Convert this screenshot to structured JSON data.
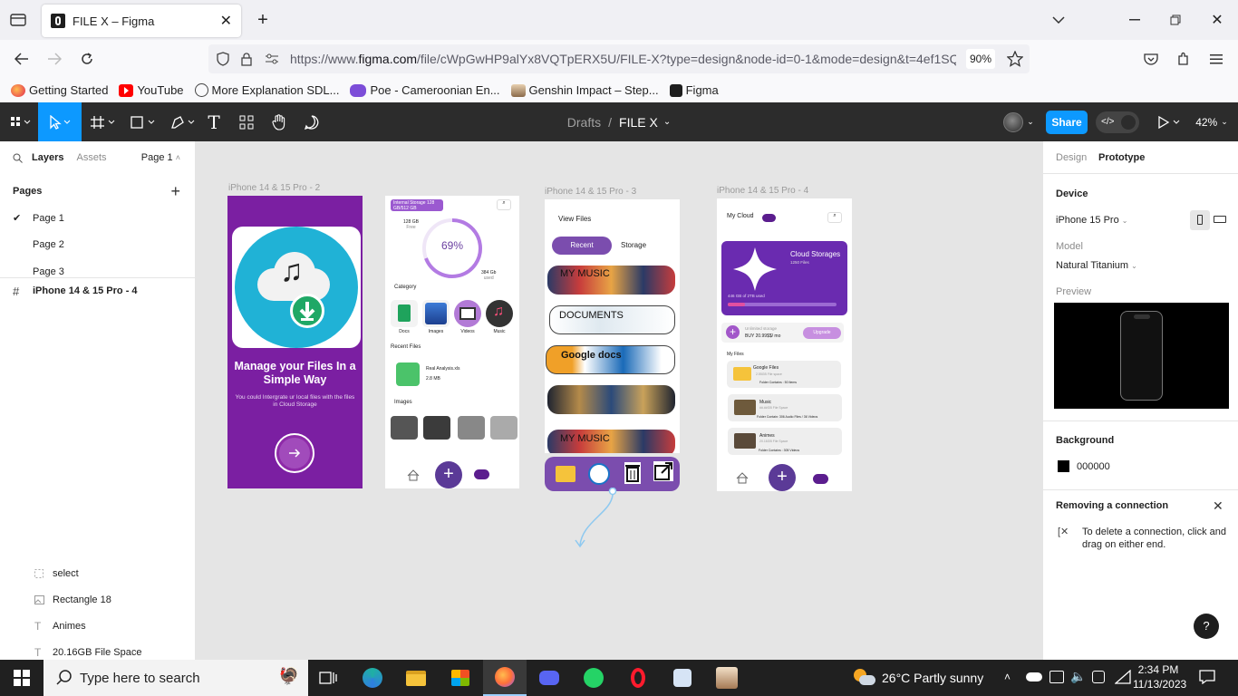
{
  "browser": {
    "tab_title": "FILE X – Figma",
    "url_prefix": "https://www.",
    "url_domain": "figma.com",
    "url_rest": "/file/cWpGwHP9alYx8VQTpERX5U/FILE-X?type=design&node-id=0-1&mode=design&t=4ef1SQ",
    "zoom": "90%",
    "bookmarks": [
      "Getting Started",
      "YouTube",
      "More Explanation SDL...",
      "Poe - Cameroonian En...",
      "Genshin Impact – Step...",
      "Figma"
    ]
  },
  "toolbar": {
    "breadcrumb_drafts": "Drafts",
    "breadcrumb_sep": "/",
    "file_name": "FILE X",
    "share_label": "Share",
    "zoom": "42%"
  },
  "left_panel": {
    "tabs": [
      "Layers",
      "Assets"
    ],
    "page_selector": "Page 1",
    "pages_title": "Pages",
    "pages": [
      "Page 1",
      "Page 2",
      "Page 3"
    ],
    "selected_frame": "iPhone 14 & 15 Pro - 4",
    "layers": [
      "select",
      "Rectangle 18",
      "Animes",
      "20.16GB File Space"
    ]
  },
  "canvas": {
    "frame_labels": [
      "iPhone 14 & 15 Pro - 2",
      "iPhone 14 & 15 Pro - 3",
      "iPhone 14 & 15 Pro - 4"
    ],
    "f1": {
      "title": "Manage your Files In a Simple Way",
      "subtitle": "You could Intergrate ur  local files with the files in Cloud Storage"
    },
    "f2": {
      "storage_badge": "Internal Storage 128 GB/512 GB",
      "total": "128 GB",
      "total_sub": "Free",
      "percent": "69%",
      "used": "384 Gb",
      "used_sub": "used",
      "category": "Category",
      "cats": [
        "Docs",
        "Images",
        "Videos",
        "Music"
      ],
      "recent": "Recent Files",
      "recent_file": "Real Analysis.xls",
      "recent_size": "2.8 MB",
      "images": "Images"
    },
    "f3": {
      "view_files": "View Files",
      "tab_recent": "Recent",
      "tab_storage": "Storage",
      "cards": [
        "MY MUSIC",
        "DOCUMENTS",
        "Google docs",
        "",
        "MY MUSIC"
      ]
    },
    "f4": {
      "title": "My Cloud",
      "cloud_storages": "Cloud Storages",
      "cloud_files": "1250 Files",
      "usage_text": "446 GB of 2TB used",
      "unlimited": "Unlimited storage",
      "buy": "BUY 20.99$$/ mo",
      "upgrade": "Upgrade",
      "my_files": "My Files",
      "folders": [
        {
          "name": "Google Files",
          "size": "2.55GB File space",
          "meta": "Folder Contains : 50 Items"
        },
        {
          "name": "Music",
          "size": "##.##GB File Space",
          "meta": "Folder Contain: 306 Audio Files / 36 Videos"
        },
        {
          "name": "Animes",
          "size": "20.16GB File Space",
          "meta": "Folder Contains : 305 Videos"
        }
      ]
    }
  },
  "right_panel": {
    "tabs": [
      "Design",
      "Prototype"
    ],
    "device_title": "Device",
    "device": "iPhone 15 Pro",
    "model_label": "Model",
    "model": "Natural Titanium",
    "preview_label": "Preview",
    "background_title": "Background",
    "background_hex": "000000",
    "note_title": "Removing a connection",
    "note_text": "To delete a connection, click and drag on either end.",
    "help": "?"
  },
  "taskbar": {
    "search_placeholder": "Type here to search",
    "weather": "26°C  Partly sunny",
    "time": "2:34 PM",
    "date": "11/13/2023"
  },
  "colors": {
    "purple": "#7b1fa2",
    "accent": "#6a3fa0",
    "cyan": "#20b2d6",
    "figma_blue": "#0d99ff",
    "toolbar": "#2c2c2c"
  }
}
